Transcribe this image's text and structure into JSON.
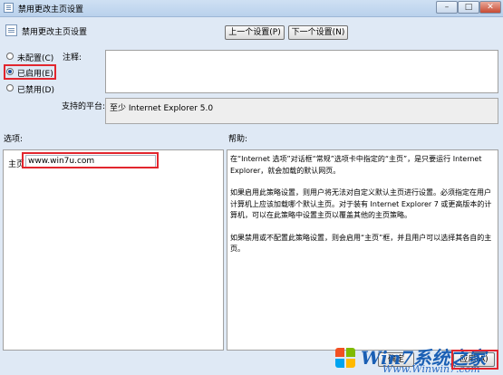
{
  "window": {
    "title": "禁用更改主页设置",
    "controls": {
      "minimize": "–",
      "maximize": "□",
      "close": "✕"
    }
  },
  "header": {
    "policy_name": "禁用更改主页设置",
    "prev_button": "上一个设置(P)",
    "next_button": "下一个设置(N)"
  },
  "state": {
    "options": [
      {
        "label": "未配置(C)",
        "selected": false
      },
      {
        "label": "已启用(E)",
        "selected": true
      },
      {
        "label": "已禁用(D)",
        "selected": false
      }
    ]
  },
  "comment": {
    "label": "注释:",
    "value": ""
  },
  "platform": {
    "label": "支持的平台:",
    "value": "至少 Internet Explorer 5.0"
  },
  "options_section": {
    "label": "选项:",
    "homepage_label": "主页",
    "homepage_value": "www.win7u.com"
  },
  "help_section": {
    "label": "帮助:",
    "paragraphs": [
      "在“Internet 选项”对话框“常规”选项卡中指定的“主页”，是只要运行 Internet Explorer，就会加载的默认网页。",
      "如果启用此策略设置，则用户将无法对自定义默认主页进行设置。必须指定在用户计算机上应该加载哪个默认主页。对于装有 Internet Explorer 7 或更高版本的计算机，可以在此策略中设置主页以覆盖其他的主页策略。",
      "如果禁用或不配置此策略设置，则会启用“主页”框，并且用户可以选择其各自的主页。"
    ]
  },
  "footer": {
    "ok_button": "确定",
    "apply_button": "应用(A)"
  },
  "watermark": {
    "text": "Win7系统之家",
    "url": "Www.Winwin7.com"
  },
  "colors": {
    "highlight_border": "#e2262e",
    "dialog_bg": "#dfe9f5",
    "watermark": "#1a5fb4"
  }
}
